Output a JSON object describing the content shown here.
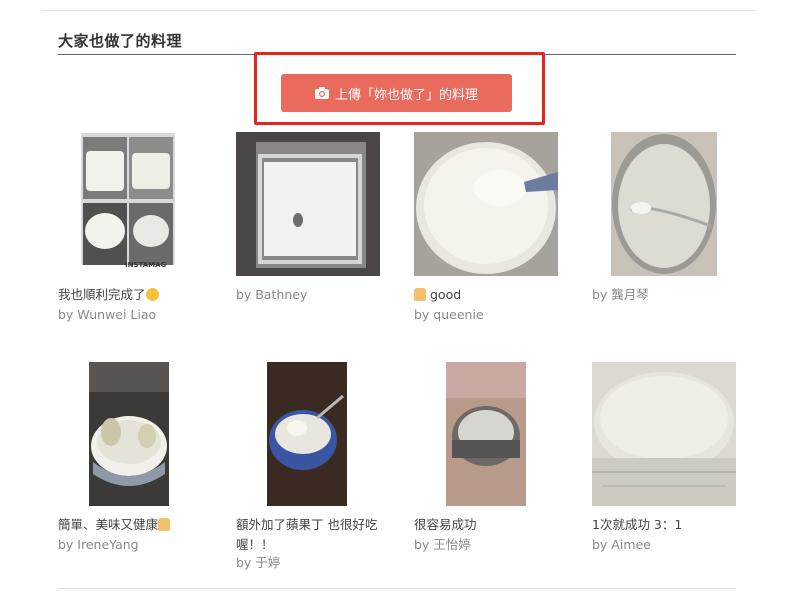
{
  "section": {
    "title": "大家也做了的料理"
  },
  "upload": {
    "label": "上傳「妳也做了」的料理",
    "icon": "camera-icon"
  },
  "cards": [
    {
      "caption": "我也順利完成了",
      "emoji": "smile",
      "author": "by Wunwei Liao",
      "watermark": "INSTAMAG"
    },
    {
      "caption": "",
      "author": "by Bathney"
    },
    {
      "caption": "good",
      "emoji": "thumbs-up",
      "author": "by queenie"
    },
    {
      "caption": "",
      "author": "by 龔月琴"
    },
    {
      "caption": "簡單、美味又健康",
      "emoji": "thumbs-up",
      "author": "by IreneYang"
    },
    {
      "caption": "額外加了蘋果丁 也很好吃喔！！",
      "author": "by 于婷"
    },
    {
      "caption": "很容易成功",
      "author": "by 王怡婷"
    },
    {
      "caption": "1次就成功 3：1",
      "author": "by Aimee"
    }
  ],
  "colors": {
    "button": "#e86b5e",
    "highlight": "#e5261f"
  }
}
